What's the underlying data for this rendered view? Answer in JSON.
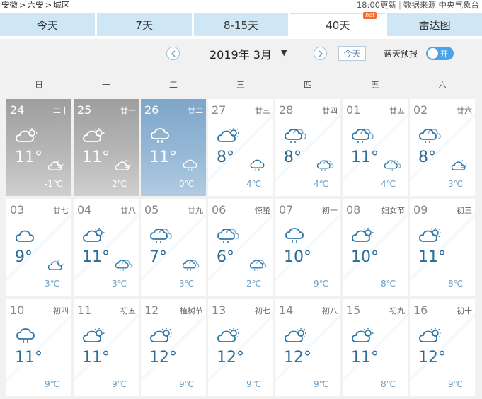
{
  "breadcrumb": [
    "安徽",
    ">",
    "六安",
    ">",
    "城区"
  ],
  "update_time": "18:00更新",
  "separator": "|",
  "source": "数据来源 中央气象台",
  "tabs": [
    {
      "label": "今天",
      "active": false
    },
    {
      "label": "7天",
      "active": false
    },
    {
      "label": "8-15天",
      "active": false
    },
    {
      "label": "40天",
      "active": true,
      "badge": "hot"
    },
    {
      "label": "雷达图",
      "active": false
    }
  ],
  "month_nav": {
    "prev_icon": "chevron-left-icon",
    "next_icon": "chevron-right-icon",
    "month": "2019年 3月",
    "caret": "▼",
    "today_button": "今天",
    "bluesky_label": "蓝天预报",
    "toggle_label": "开",
    "toggle_on": true
  },
  "weekdays": [
    "日",
    "一",
    "二",
    "三",
    "四",
    "五",
    "六"
  ],
  "colors": {
    "accent": "#4aa3e6",
    "tab_bg": "#cfe6f5",
    "temp_high": "#2a6a93",
    "temp_low": "#6a9fc4",
    "past_cell": "#b6b6b6",
    "today_cell": "#95b8d6"
  },
  "days": [
    {
      "day": "24",
      "lunar": "二十",
      "state": "past",
      "day_icon": "sun-cloud-icon",
      "high": "11°",
      "night_icon": "cloud-moon-icon",
      "low": "-1℃"
    },
    {
      "day": "25",
      "lunar": "廿一",
      "state": "past",
      "day_icon": "sun-cloud-icon",
      "high": "11°",
      "night_icon": "cloud-moon-icon",
      "low": "2℃"
    },
    {
      "day": "26",
      "lunar": "廿二",
      "state": "today",
      "day_icon": "cloud-rain-icon",
      "high": "11°",
      "night_icon": "cloud-rain-icon",
      "low": "0℃"
    },
    {
      "day": "27",
      "lunar": "廿三",
      "state": "future",
      "day_icon": "sun-cloud-icon",
      "high": "8°",
      "night_icon": "cloud-rain-icon",
      "low": "4℃"
    },
    {
      "day": "28",
      "lunar": "廿四",
      "state": "future",
      "day_icon": "clouds-rain-icon",
      "high": "8°",
      "night_icon": "clouds-rain-icon",
      "low": "4℃"
    },
    {
      "day": "01",
      "lunar": "廿五",
      "state": "future",
      "day_icon": "clouds-rain-icon",
      "high": "11°",
      "night_icon": "clouds-rain-icon",
      "low": "4℃"
    },
    {
      "day": "02",
      "lunar": "廿六",
      "state": "future",
      "day_icon": "clouds-rain-icon",
      "high": "8°",
      "night_icon": "cloud-moon-icon",
      "low": "3℃"
    },
    {
      "day": "03",
      "lunar": "廿七",
      "state": "future",
      "day_icon": "cloud-icon",
      "high": "9°",
      "night_icon": "cloud-moon-icon",
      "low": "3℃"
    },
    {
      "day": "04",
      "lunar": "廿八",
      "state": "future",
      "day_icon": "sun-cloud-icon",
      "high": "11°",
      "night_icon": "clouds-rain-icon",
      "low": "3℃"
    },
    {
      "day": "05",
      "lunar": "廿九",
      "state": "future",
      "day_icon": "clouds-rain-icon",
      "high": "7°",
      "night_icon": "clouds-rain-icon",
      "low": "3℃"
    },
    {
      "day": "06",
      "lunar": "惊蛰",
      "state": "future",
      "day_icon": "clouds-rain-icon",
      "high": "6°",
      "night_icon": "clouds-rain-icon",
      "low": "2℃"
    },
    {
      "day": "07",
      "lunar": "初一",
      "state": "future",
      "day_icon": "cloud-rain-icon",
      "high": "10°",
      "night_icon": "",
      "low": "9℃"
    },
    {
      "day": "08",
      "lunar": "妇女节",
      "state": "future",
      "day_icon": "sun-cloud-icon",
      "high": "10°",
      "night_icon": "",
      "low": "8℃"
    },
    {
      "day": "09",
      "lunar": "初三",
      "state": "future",
      "day_icon": "sun-cloud-icon",
      "high": "11°",
      "night_icon": "",
      "low": "8℃"
    },
    {
      "day": "10",
      "lunar": "初四",
      "state": "future",
      "day_icon": "cloud-rain-icon",
      "high": "11°",
      "night_icon": "",
      "low": "9℃"
    },
    {
      "day": "11",
      "lunar": "初五",
      "state": "future",
      "day_icon": "sun-cloud-icon",
      "high": "11°",
      "night_icon": "",
      "low": "9℃"
    },
    {
      "day": "12",
      "lunar": "植树节",
      "state": "future",
      "day_icon": "sun-cloud-icon",
      "high": "12°",
      "night_icon": "",
      "low": "9℃"
    },
    {
      "day": "13",
      "lunar": "初七",
      "state": "future",
      "day_icon": "sun-cloud-icon",
      "high": "12°",
      "night_icon": "",
      "low": "9℃"
    },
    {
      "day": "14",
      "lunar": "初八",
      "state": "future",
      "day_icon": "sun-cloud-icon",
      "high": "12°",
      "night_icon": "",
      "low": "9℃"
    },
    {
      "day": "15",
      "lunar": "初九",
      "state": "future",
      "day_icon": "sun-cloud-icon",
      "high": "11°",
      "night_icon": "",
      "low": "8℃"
    },
    {
      "day": "16",
      "lunar": "初十",
      "state": "future",
      "day_icon": "sun-cloud-icon",
      "high": "12°",
      "night_icon": "",
      "low": "9℃"
    }
  ]
}
